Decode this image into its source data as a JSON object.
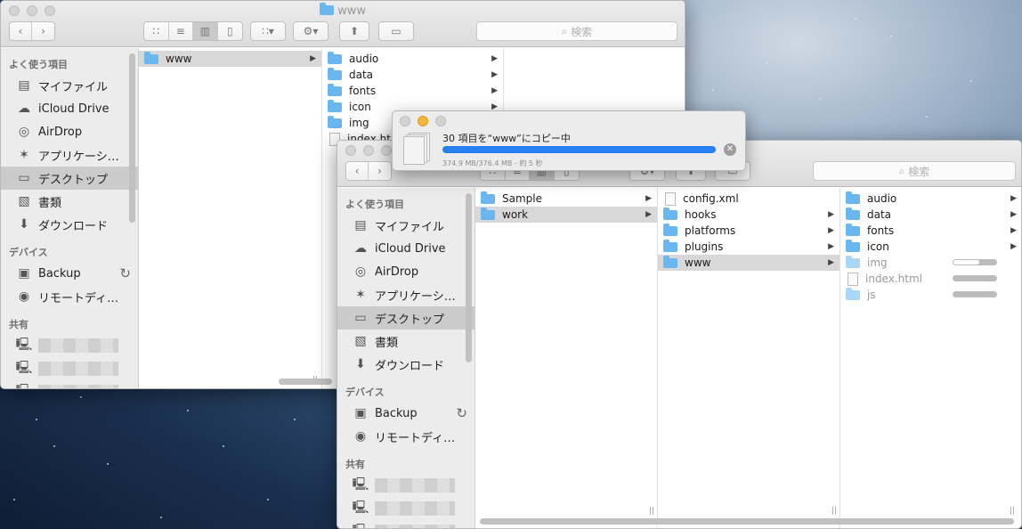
{
  "window_back": {
    "title": "www",
    "search_placeholder": "検索",
    "sidebar": {
      "favorites_header": "よく使う項目",
      "favorites": [
        {
          "label": "マイファイル",
          "icon": "all-files-icon"
        },
        {
          "label": "iCloud Drive",
          "icon": "cloud-icon"
        },
        {
          "label": "AirDrop",
          "icon": "airdrop-icon"
        },
        {
          "label": "アプリケーシ…",
          "icon": "applications-icon"
        },
        {
          "label": "デスクトップ",
          "icon": "desktop-icon",
          "selected": true
        },
        {
          "label": "書類",
          "icon": "documents-icon"
        },
        {
          "label": "ダウンロード",
          "icon": "downloads-icon"
        }
      ],
      "devices_header": "デバイス",
      "devices": [
        {
          "label": "Backup",
          "icon": "disk-icon"
        },
        {
          "label": "リモートディ…",
          "icon": "disc-icon"
        }
      ],
      "shared_header": "共有"
    },
    "col1": [
      {
        "name": "www",
        "type": "folder",
        "selected": true
      }
    ],
    "col2": [
      {
        "name": "audio",
        "type": "folder"
      },
      {
        "name": "data",
        "type": "folder"
      },
      {
        "name": "fonts",
        "type": "folder"
      },
      {
        "name": "icon",
        "type": "folder"
      },
      {
        "name": "img",
        "type": "folder"
      },
      {
        "name": "index.htm",
        "type": "file"
      }
    ]
  },
  "window_front": {
    "search_placeholder": "検索",
    "sidebar": {
      "favorites_header": "よく使う項目",
      "favorites": [
        {
          "label": "マイファイル",
          "icon": "all-files-icon"
        },
        {
          "label": "iCloud Drive",
          "icon": "cloud-icon"
        },
        {
          "label": "AirDrop",
          "icon": "airdrop-icon"
        },
        {
          "label": "アプリケーシ…",
          "icon": "applications-icon"
        },
        {
          "label": "デスクトップ",
          "icon": "desktop-icon",
          "selected": true
        },
        {
          "label": "書類",
          "icon": "documents-icon"
        },
        {
          "label": "ダウンロード",
          "icon": "downloads-icon"
        }
      ],
      "devices_header": "デバイス",
      "devices": [
        {
          "label": "Backup",
          "icon": "disk-icon"
        },
        {
          "label": "リモートディ…",
          "icon": "disc-icon"
        }
      ],
      "shared_header": "共有"
    },
    "col1": [
      {
        "name": "Sample",
        "type": "folder"
      },
      {
        "name": "work",
        "type": "folder",
        "selected": true
      }
    ],
    "col2": [
      {
        "name": "config.xml",
        "type": "file"
      },
      {
        "name": "hooks",
        "type": "folder"
      },
      {
        "name": "platforms",
        "type": "folder"
      },
      {
        "name": "plugins",
        "type": "folder"
      },
      {
        "name": "www",
        "type": "folder",
        "selected": true
      }
    ],
    "col3": [
      {
        "name": "audio",
        "type": "folder"
      },
      {
        "name": "data",
        "type": "folder"
      },
      {
        "name": "fonts",
        "type": "folder"
      },
      {
        "name": "icon",
        "type": "folder"
      },
      {
        "name": "img",
        "type": "folder",
        "copying": true,
        "progress": 0.6
      },
      {
        "name": "index.html",
        "type": "file",
        "copying": true,
        "progress": 0
      },
      {
        "name": "js",
        "type": "folder",
        "copying": true,
        "progress": 0
      }
    ]
  },
  "copy_dialog": {
    "title": "30 項目を“www”にコピー中",
    "status": "374.9 MB/376.4 MB - 約 5 秒",
    "progress": 0.996,
    "accent": "#2a7ff0"
  }
}
